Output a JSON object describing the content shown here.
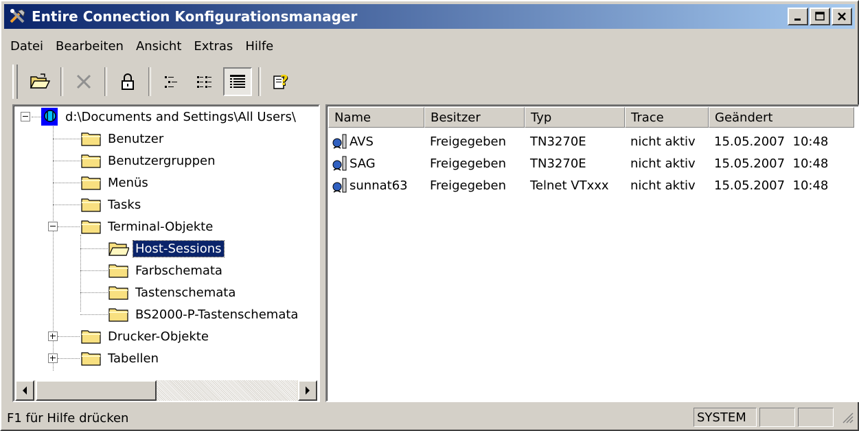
{
  "window": {
    "title": "Entire Connection Konfigurationsmanager"
  },
  "menu": [
    "Datei",
    "Bearbeiten",
    "Ansicht",
    "Extras",
    "Hilfe"
  ],
  "toolbar": {
    "tools": [
      {
        "icon": "open-folder-icon"
      },
      {
        "icon": "delete-x-icon"
      },
      {
        "icon": "lock-icon"
      },
      {
        "icon": "list-view-icon"
      },
      {
        "icon": "small-icons-view-icon"
      },
      {
        "icon": "details-view-icon",
        "pressed": true
      },
      {
        "icon": "help-icon"
      }
    ]
  },
  "tree": {
    "root": "d:\\Documents and Settings\\All Users\\",
    "items": {
      "benutzer": "Benutzer",
      "benutzergruppen": "Benutzergruppen",
      "menus": "Menüs",
      "tasks": "Tasks",
      "terminal": "Terminal-Objekte",
      "host_sessions": "Host-Sessions",
      "farbschemata": "Farbschemata",
      "tastenschemata": "Tastenschemata",
      "bs2000": "BS2000-P-Tastenschemata",
      "drucker": "Drucker-Objekte",
      "tabellen": "Tabellen"
    },
    "selected": "Host-Sessions"
  },
  "list": {
    "columns": [
      "Name",
      "Besitzer",
      "Typ",
      "Trace",
      "Geändert"
    ],
    "rows": [
      [
        "AVS",
        "Freigegeben",
        "TN3270E",
        "nicht aktiv",
        "15.05.2007  10:48"
      ],
      [
        "SAG",
        "Freigegeben",
        "TN3270E",
        "nicht aktiv",
        "15.05.2007  10:48"
      ],
      [
        "sunnat63",
        "Freigegeben",
        "Telnet VTxxx",
        "nicht aktiv",
        "15.05.2007  10:48"
      ]
    ]
  },
  "status": {
    "text": "F1 für Hilfe drücken",
    "user": "SYSTEM"
  },
  "colors": {
    "titlebar_start": "#0a246a",
    "titlebar_end": "#a6caf0",
    "selection": "#0a246a",
    "face": "#d4d0c8"
  }
}
